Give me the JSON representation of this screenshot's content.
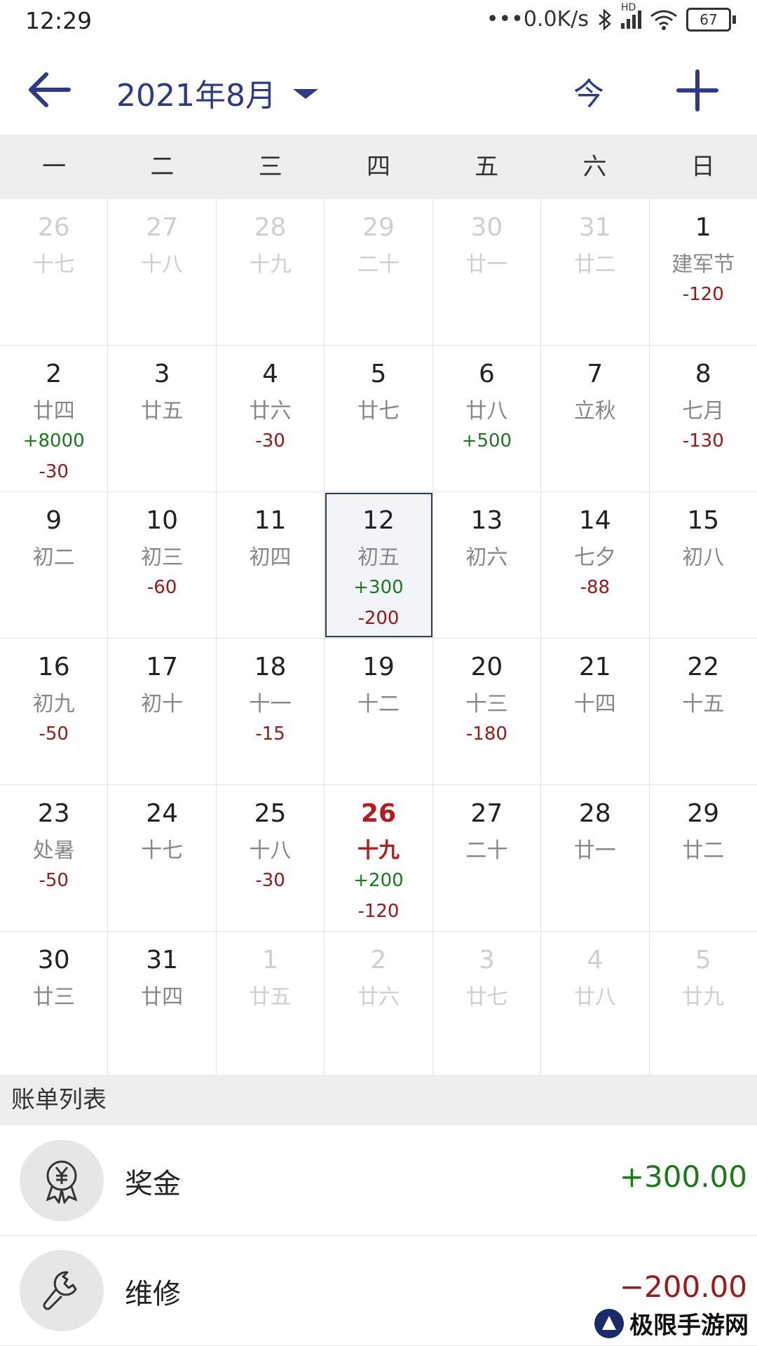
{
  "statusbar": {
    "time": "12:29",
    "network": "•••0.0K/s",
    "signal": "HD",
    "battery": "67"
  },
  "header": {
    "title": "2021年8月",
    "today_label": "今"
  },
  "weekdays": [
    "一",
    "二",
    "三",
    "四",
    "五",
    "六",
    "日"
  ],
  "calendar": [
    [
      {
        "day": "26",
        "lunar": "十七",
        "dim": true
      },
      {
        "day": "27",
        "lunar": "十八",
        "dim": true
      },
      {
        "day": "28",
        "lunar": "十九",
        "dim": true
      },
      {
        "day": "29",
        "lunar": "二十",
        "dim": true
      },
      {
        "day": "30",
        "lunar": "廿一",
        "dim": true
      },
      {
        "day": "31",
        "lunar": "廿二",
        "dim": true
      },
      {
        "day": "1",
        "lunar": "建军节",
        "amounts": [
          "-120"
        ]
      }
    ],
    [
      {
        "day": "2",
        "lunar": "廿四",
        "amounts": [
          "+8000",
          "-30"
        ]
      },
      {
        "day": "3",
        "lunar": "廿五"
      },
      {
        "day": "4",
        "lunar": "廿六",
        "amounts": [
          "-30"
        ]
      },
      {
        "day": "5",
        "lunar": "廿七"
      },
      {
        "day": "6",
        "lunar": "廿八",
        "amounts": [
          "+500"
        ]
      },
      {
        "day": "7",
        "lunar": "立秋"
      },
      {
        "day": "8",
        "lunar": "七月",
        "amounts": [
          "-130"
        ]
      }
    ],
    [
      {
        "day": "9",
        "lunar": "初二"
      },
      {
        "day": "10",
        "lunar": "初三",
        "amounts": [
          "-60"
        ]
      },
      {
        "day": "11",
        "lunar": "初四"
      },
      {
        "day": "12",
        "lunar": "初五",
        "amounts": [
          "+300",
          "-200"
        ],
        "selected": true
      },
      {
        "day": "13",
        "lunar": "初六"
      },
      {
        "day": "14",
        "lunar": "七夕",
        "amounts": [
          "-88"
        ]
      },
      {
        "day": "15",
        "lunar": "初八"
      }
    ],
    [
      {
        "day": "16",
        "lunar": "初九",
        "amounts": [
          "-50"
        ]
      },
      {
        "day": "17",
        "lunar": "初十"
      },
      {
        "day": "18",
        "lunar": "十一",
        "amounts": [
          "-15"
        ]
      },
      {
        "day": "19",
        "lunar": "十二"
      },
      {
        "day": "20",
        "lunar": "十三",
        "amounts": [
          "-180"
        ]
      },
      {
        "day": "21",
        "lunar": "十四"
      },
      {
        "day": "22",
        "lunar": "十五"
      }
    ],
    [
      {
        "day": "23",
        "lunar": "处暑",
        "amounts": [
          "-50"
        ]
      },
      {
        "day": "24",
        "lunar": "十七"
      },
      {
        "day": "25",
        "lunar": "十八",
        "amounts": [
          "-30"
        ]
      },
      {
        "day": "26",
        "lunar": "十九",
        "amounts": [
          "+200",
          "-120"
        ],
        "today": true
      },
      {
        "day": "27",
        "lunar": "二十"
      },
      {
        "day": "28",
        "lunar": "廿一"
      },
      {
        "day": "29",
        "lunar": "廿二"
      }
    ],
    [
      {
        "day": "30",
        "lunar": "廿三"
      },
      {
        "day": "31",
        "lunar": "廿四"
      },
      {
        "day": "1",
        "lunar": "廿五",
        "dim": true
      },
      {
        "day": "2",
        "lunar": "廿六",
        "dim": true
      },
      {
        "day": "3",
        "lunar": "廿七",
        "dim": true
      },
      {
        "day": "4",
        "lunar": "廿八",
        "dim": true
      },
      {
        "day": "5",
        "lunar": "廿九",
        "dim": true
      }
    ]
  ],
  "bill_list": {
    "title": "账单列表",
    "items": [
      {
        "name": "奖金",
        "amount": "+300.00",
        "icon": "bonus-medal-icon"
      },
      {
        "name": "维修",
        "amount": "−200.00",
        "icon": "wrench-icon"
      }
    ]
  },
  "colors": {
    "accent": "#2d3a8c",
    "income": "#1b7a1b",
    "expense": "#a01818",
    "today": "#b71c1c"
  },
  "watermark": {
    "text": "极限手游网"
  }
}
